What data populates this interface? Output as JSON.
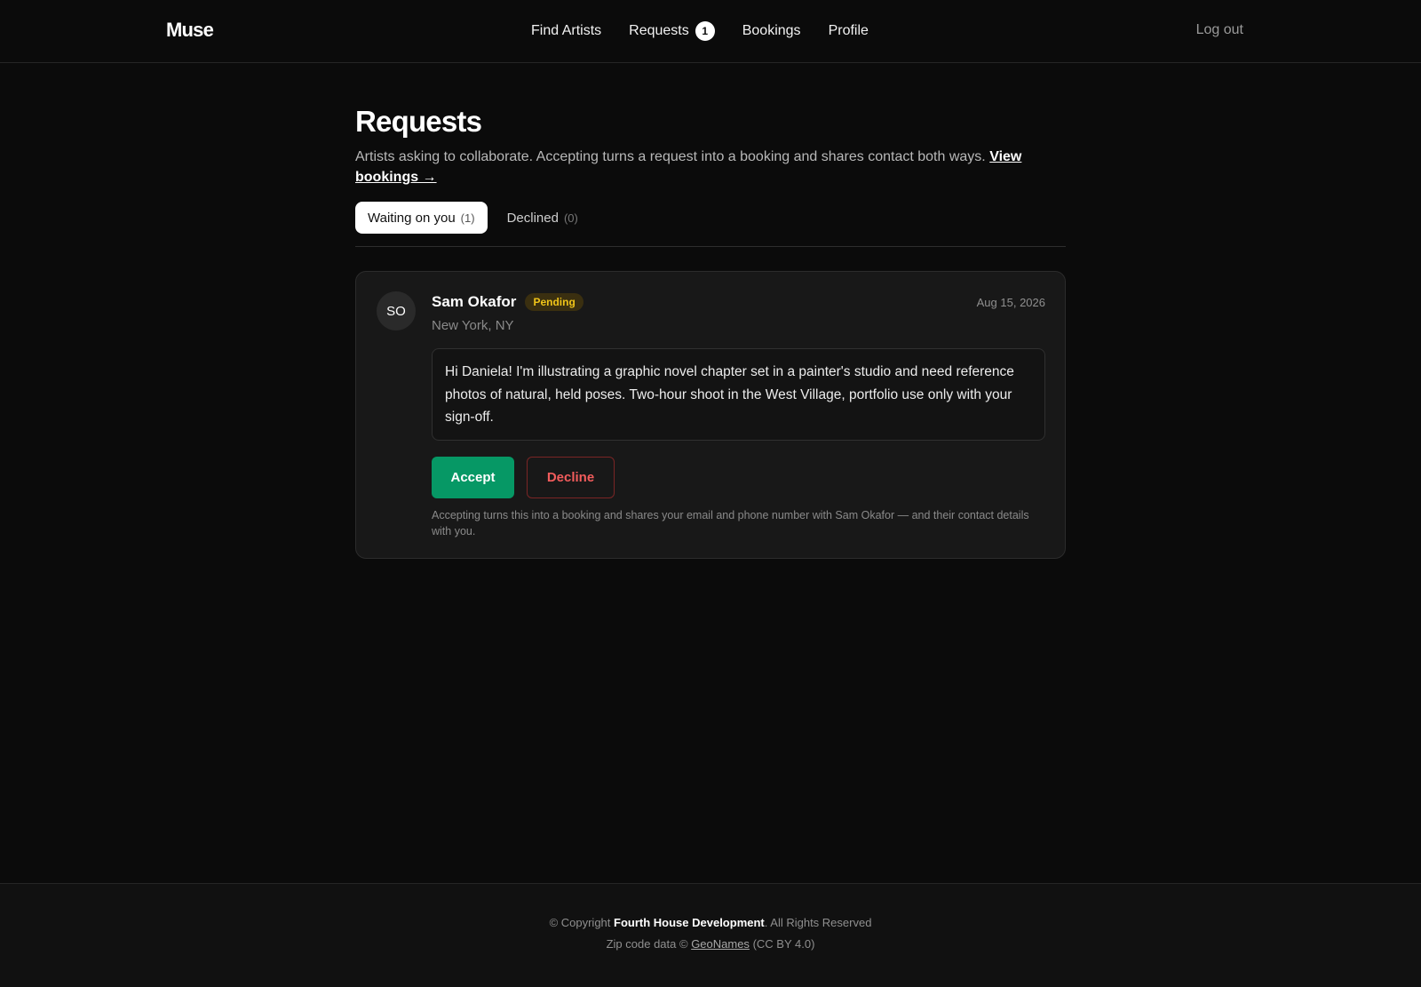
{
  "header": {
    "logo": "Muse",
    "nav": [
      {
        "label": "Find Artists"
      },
      {
        "label": "Requests",
        "badge": "1"
      },
      {
        "label": "Bookings"
      },
      {
        "label": "Profile"
      }
    ],
    "logout": "Log out"
  },
  "page": {
    "title": "Requests",
    "subtitle": "Artists asking to collaborate. Accepting turns a request into a booking and shares contact both ways.",
    "subtitle_link": "View bookings →"
  },
  "tabs": [
    {
      "label": "Waiting on you",
      "count": "(1)",
      "active": true
    },
    {
      "label": "Declined",
      "count": "(0)",
      "active": false
    }
  ],
  "request": {
    "initials": "SO",
    "name": "Sam Okafor",
    "status": "Pending",
    "location": "New York, NY",
    "date": "Aug 15, 2026",
    "message": "Hi Daniela! I'm illustrating a graphic novel chapter set in a painter's studio and need reference photos of natural, held poses. Two-hour shoot in the West Village, portfolio use only with your sign-off.",
    "accept_label": "Accept",
    "decline_label": "Decline",
    "note": "Accepting turns this into a booking and shares your email and phone number with Sam Okafor — and their contact details with you."
  },
  "footer": {
    "copyright_prefix": "© Copyright",
    "company": "Fourth House Development",
    "copyright_suffix": ". All Rights Reserved",
    "zip_prefix": "Zip code data ©",
    "zip_link": "GeoNames",
    "zip_suffix": "(CC BY 4.0)"
  },
  "colors": {
    "background": "#0b0b0b",
    "accept": "#069865",
    "decline": "#f25c5c",
    "pending": "#f0c419"
  }
}
